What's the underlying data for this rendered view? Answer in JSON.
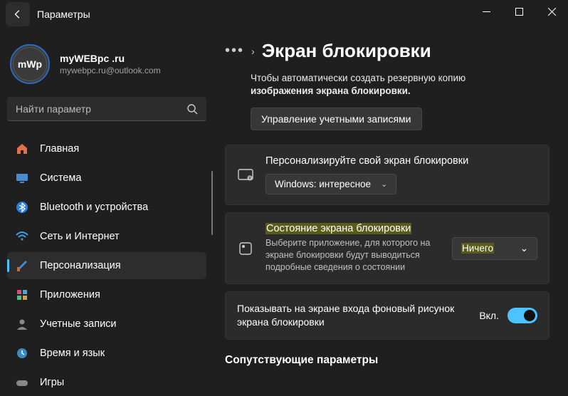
{
  "titlebar": {
    "title": "Параметры"
  },
  "profile": {
    "avatar_text": "mWp",
    "name": "myWEBpc .ru",
    "email": "mywebpc.ru@outlook.com"
  },
  "search": {
    "placeholder": "Найти параметр"
  },
  "nav": {
    "items": [
      {
        "label": "Главная"
      },
      {
        "label": "Система"
      },
      {
        "label": "Bluetooth и устройства"
      },
      {
        "label": "Сеть и Интернет"
      },
      {
        "label": "Персонализация"
      },
      {
        "label": "Приложения"
      },
      {
        "label": "Учетные записи"
      },
      {
        "label": "Время и язык"
      },
      {
        "label": "Игры"
      }
    ]
  },
  "page": {
    "title": "Экран блокировки",
    "desc_line1": "Чтобы автоматически создать резервную копию",
    "desc_line2": "изображения экрана блокировки.",
    "manage_btn": "Управление учетными записями",
    "personalize": {
      "title": "Персонализируйте свой экран блокировки",
      "dropdown": "Windows: интересное"
    },
    "status": {
      "title": "Состояние экрана блокировки",
      "sub": "Выберите приложение, для которого на экране блокировки будут выводиться подробные сведения о состоянии",
      "dropdown": "Ничего"
    },
    "bg_toggle": {
      "label": "Показывать на экране входа фоновый рисунок экрана блокировки",
      "state": "Вкл."
    },
    "related": "Сопутствующие параметры"
  }
}
